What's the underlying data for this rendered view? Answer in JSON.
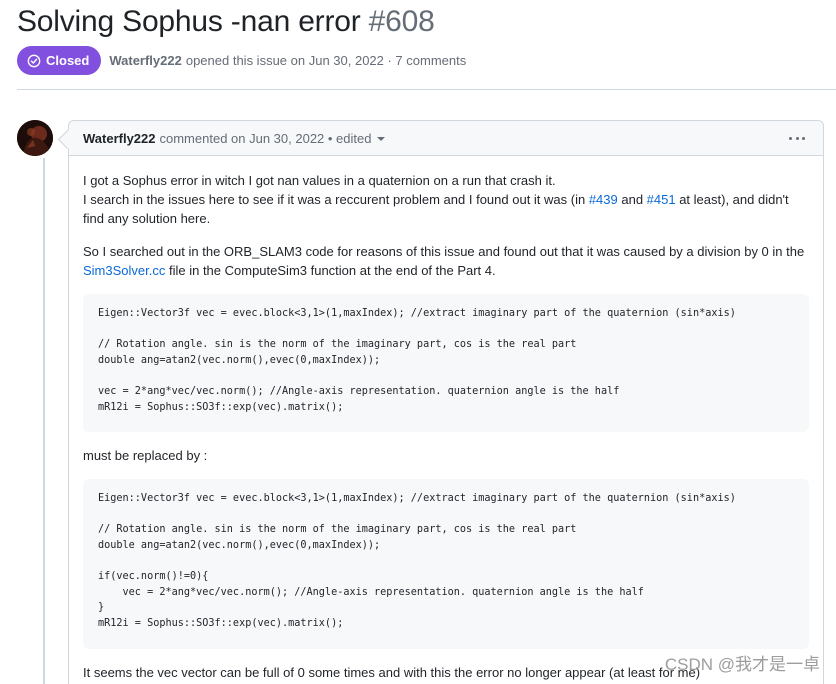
{
  "issue": {
    "title": "Solving Sophus -nan error",
    "number": "#608",
    "status": "Closed",
    "author": "Waterfly222",
    "opened_text": "opened this issue on Jun 30, 2022 · 7 comments"
  },
  "comment": {
    "author": "Waterfly222",
    "meta": "commented on Jun 30, 2022 • edited",
    "icons": {
      "avatar": "avatar",
      "options": "kebab-horizontal-icon",
      "status": "issue-closed-icon"
    },
    "p1_line1": "I got a Sophus error in witch I got nan values in a quaternion on a run that crash it.",
    "p1_line2_a": "I search in the issues here to see if it was a reccurent problem and I found out it was (in ",
    "link_439": "#439",
    "p1_line2_b": " and ",
    "link_451": "#451",
    "p1_line2_c": " at least), and didn't find any solution here.",
    "p2_a": "So I searched out in the ORB_SLAM3 code for reasons of this issue and found out that it was caused by a division by 0 in the ",
    "link_file": "Sim3Solver.cc",
    "p2_b": " file in the ComputeSim3 function at the end of the Part 4.",
    "code1": "Eigen::Vector3f vec = evec.block<3,1>(1,maxIndex); //extract imaginary part of the quaternion (sin*axis)\n\n// Rotation angle. sin is the norm of the imaginary part, cos is the real part\ndouble ang=atan2(vec.norm(),evec(0,maxIndex));\n\nvec = 2*ang*vec/vec.norm(); //Angle-axis representation. quaternion angle is the half\nmR12i = Sophus::SO3f::exp(vec).matrix();",
    "p3": "must be replaced by :",
    "code2": "Eigen::Vector3f vec = evec.block<3,1>(1,maxIndex); //extract imaginary part of the quaternion (sin*axis)\n\n// Rotation angle. sin is the norm of the imaginary part, cos is the real part\ndouble ang=atan2(vec.norm(),evec(0,maxIndex));\n\nif(vec.norm()!=0){\n    vec = 2*ang*vec/vec.norm(); //Angle-axis representation. quaternion angle is the half\n}\nmR12i = Sophus::SO3f::exp(vec).matrix();",
    "p4": "It seems the vec vector can be full of 0 some times and with this the error no longer appear (at least for me)"
  },
  "watermark": "CSDN @我才是一卓",
  "colors": {
    "closed": "#8250df",
    "link": "#0969da",
    "muted": "#656d76",
    "border": "#d0d7de"
  }
}
